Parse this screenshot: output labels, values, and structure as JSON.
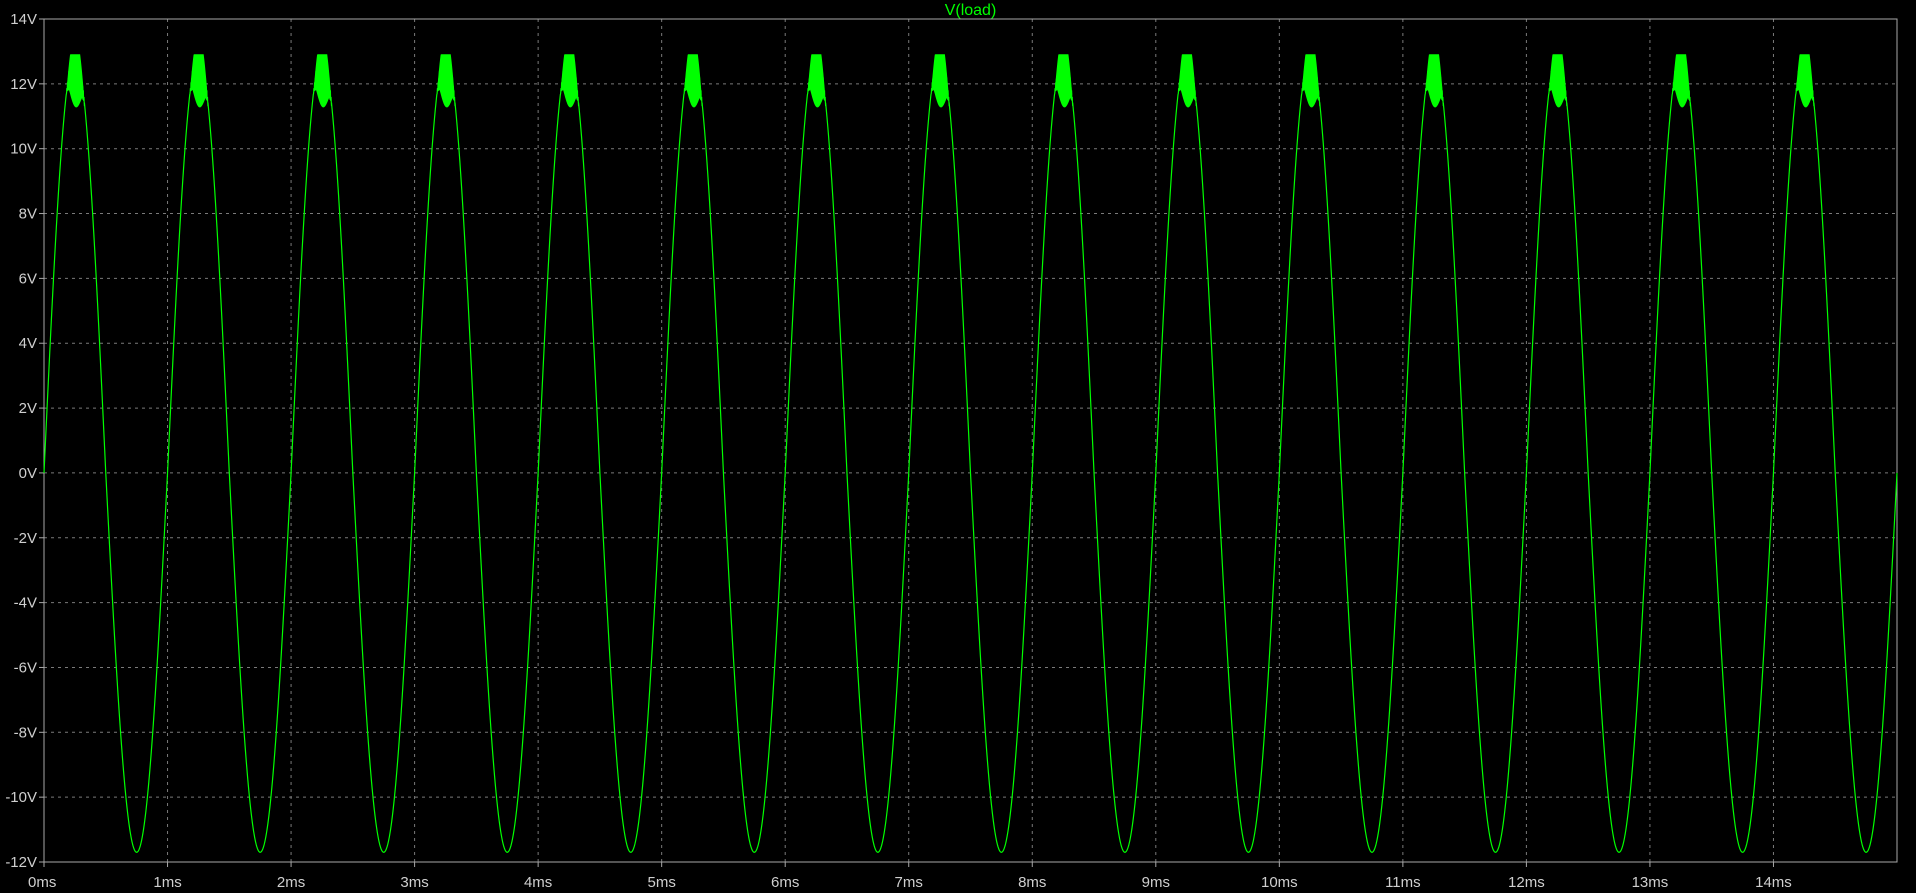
{
  "window": {
    "background": "#000000"
  },
  "chart_data": {
    "type": "line",
    "title": "V(load)",
    "xlabel": "",
    "ylabel": "",
    "xlim": [
      0,
      15
    ],
    "ylim": [
      -12,
      14
    ],
    "grid": true,
    "x_unit": "ms",
    "y_unit": "V",
    "x_ticks": [
      "0ms",
      "1ms",
      "2ms",
      "3ms",
      "4ms",
      "5ms",
      "6ms",
      "7ms",
      "8ms",
      "9ms",
      "10ms",
      "11ms",
      "12ms",
      "13ms",
      "14ms"
    ],
    "y_ticks": [
      "14V",
      "12V",
      "10V",
      "8V",
      "6V",
      "4V",
      "2V",
      "0V",
      "-2V",
      "-4V",
      "-6V",
      "-8V",
      "-10V",
      "-12V"
    ],
    "series": [
      {
        "name": "V(load)",
        "color": "#00ff00",
        "waveform": "sine with high-frequency ripple near positive peaks",
        "frequency_hz": 1000,
        "positive_peak": 12.9,
        "negative_peak": -11.7,
        "ripple_band": [
          9.2,
          12.9
        ],
        "cycles": 15,
        "x": [
          0,
          0.25,
          0.5,
          0.75,
          1.0,
          1.25,
          1.5,
          1.75,
          2.0,
          2.25,
          2.5,
          2.75,
          3.0,
          3.25,
          3.5,
          3.75,
          4.0,
          4.25,
          4.5,
          4.75,
          5.0,
          5.25,
          5.5,
          5.75,
          6.0,
          6.25,
          6.5,
          6.75,
          7.0,
          7.25,
          7.5,
          7.75,
          8.0,
          8.25,
          8.5,
          8.75,
          9.0,
          9.25,
          9.5,
          9.75,
          10.0,
          10.25,
          10.5,
          10.75,
          11.0,
          11.25,
          11.5,
          11.75,
          12.0,
          12.25,
          12.5,
          12.75,
          13.0,
          13.25,
          13.5,
          13.75,
          14.0,
          14.25,
          14.5,
          14.75,
          15.0
        ],
        "y": [
          0,
          12.9,
          0,
          -11.7,
          0,
          12.9,
          0,
          -11.7,
          0,
          12.9,
          0,
          -11.7,
          0,
          12.9,
          0,
          -11.7,
          0,
          12.9,
          0,
          -11.7,
          0,
          12.9,
          0,
          -11.7,
          0,
          12.9,
          0,
          -11.7,
          0,
          12.9,
          0,
          -11.7,
          0,
          12.9,
          0,
          -11.7,
          0,
          12.9,
          0,
          -11.7,
          0,
          12.9,
          0,
          -11.7,
          0,
          12.9,
          0,
          -11.7,
          0,
          12.9,
          0,
          -11.7,
          0,
          12.9,
          0,
          -11.7,
          0,
          12.9,
          0,
          -11.7,
          0
        ]
      }
    ]
  }
}
